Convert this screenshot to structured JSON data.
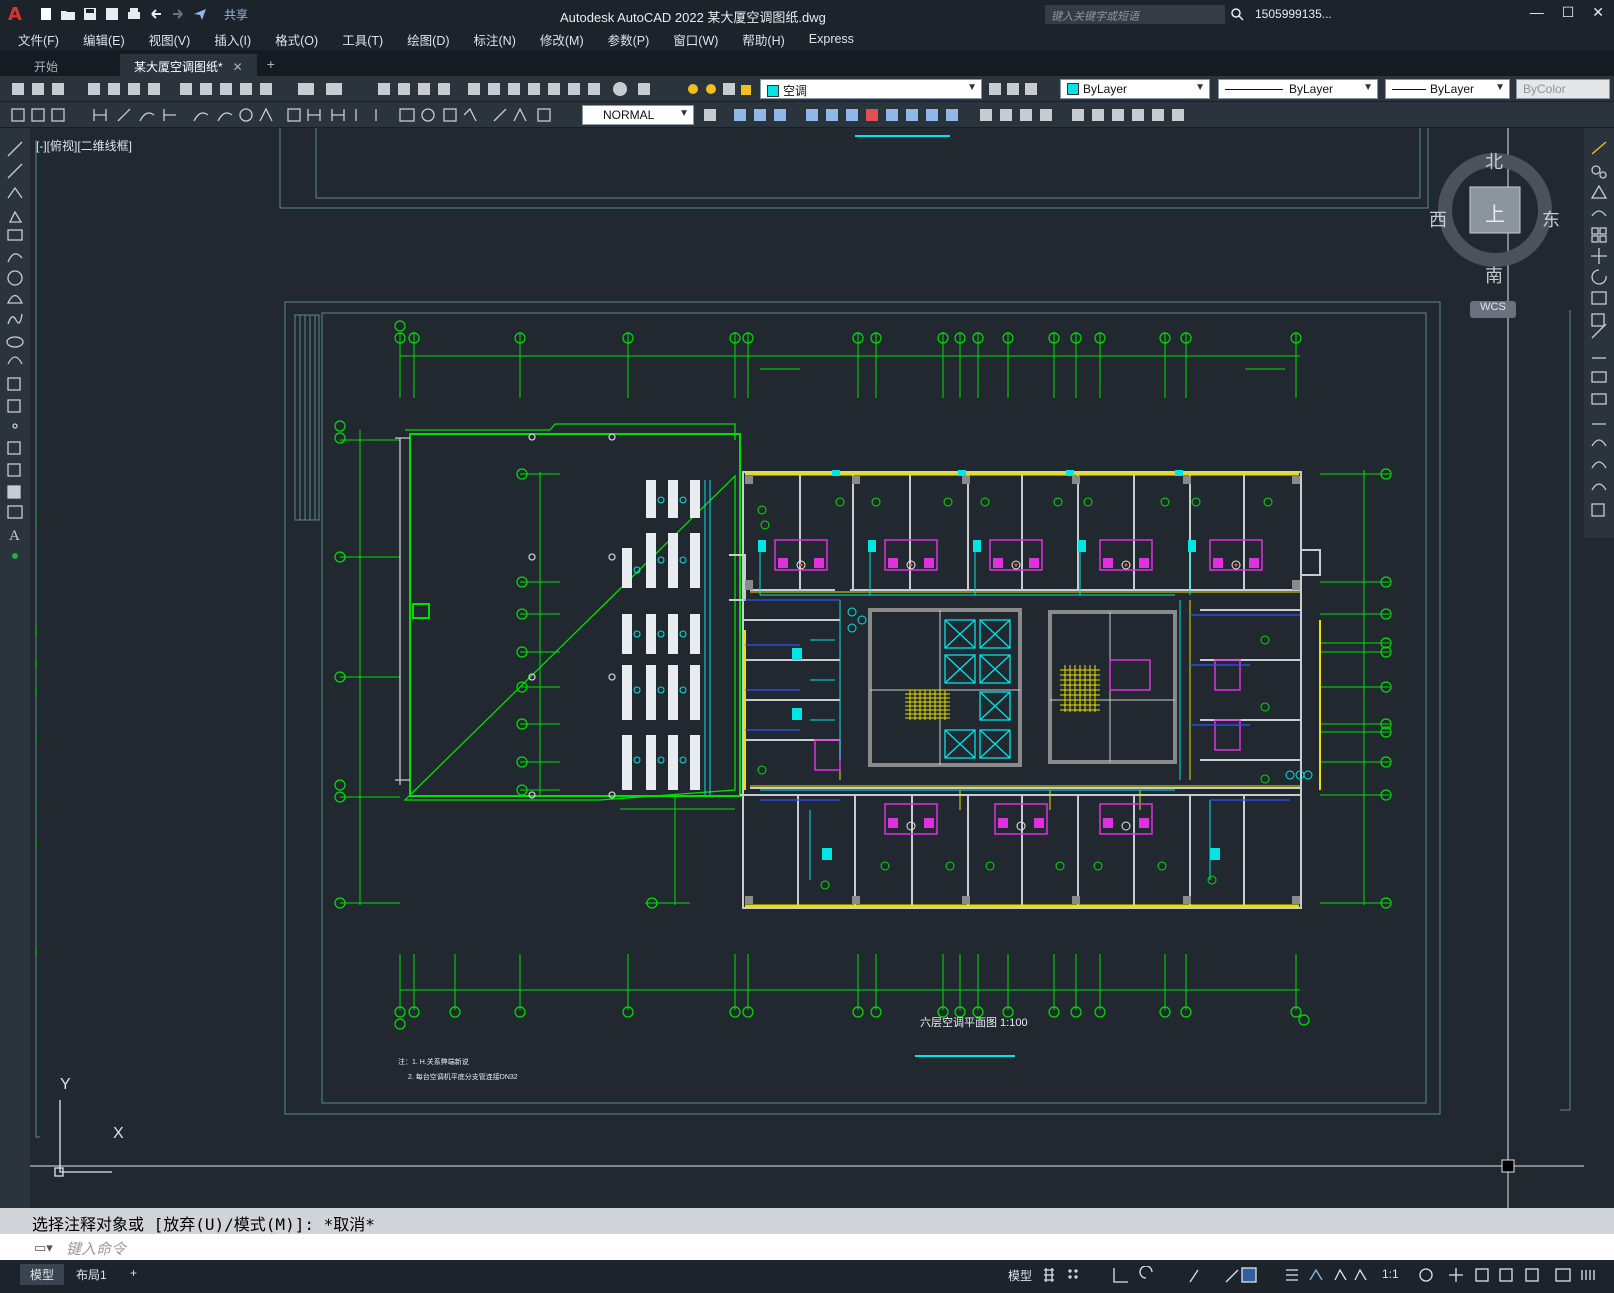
{
  "app": {
    "title": "Autodesk AutoCAD 2022    某大厦空调图纸.dwg",
    "share_label": "共享",
    "search_placeholder": "键入关键字或短语",
    "user": "1505999135...",
    "logo": "A"
  },
  "menu": [
    "文件(F)",
    "编辑(E)",
    "视图(V)",
    "插入(I)",
    "格式(O)",
    "工具(T)",
    "绘图(D)",
    "标注(N)",
    "修改(M)",
    "参数(P)",
    "窗口(W)",
    "帮助(H)",
    "Express"
  ],
  "tabs": [
    {
      "label": "开始",
      "active": false
    },
    {
      "label": "某大厦空调图纸*",
      "active": true
    }
  ],
  "toolbar": {
    "layer_name": "空调",
    "color": "ByLayer",
    "linetype": "ByLayer",
    "lineweight": "ByLayer",
    "plotstyle": "ByColor",
    "style": "NORMAL"
  },
  "viewport": {
    "label": "[-][俯视][二维线框]",
    "compass": {
      "north": "北",
      "south": "南",
      "east": "东",
      "west": "西",
      "top": "上"
    },
    "wcs": "WCS",
    "ucs_x": "X",
    "ucs_y": "Y"
  },
  "drawing": {
    "plan_title": "六层空调平面图 1:100",
    "note1": "注：1. H.关系弊端新说",
    "note2": "2. 每台空调机平底分支管连接DN32"
  },
  "command": {
    "history": "选择注释对象或 [放弃(U)/模式(M)]: *取消*",
    "input_placeholder": "键入命令"
  },
  "status": {
    "layouts": [
      "模型",
      "布局1"
    ],
    "model_label": "模型",
    "scale": "1:1"
  },
  "colors": {
    "bg": "#212830",
    "green": "#00e000",
    "cyan": "#00e5e5",
    "magenta": "#e030e0",
    "yellow": "#e8e000",
    "white": "#e8ecf0",
    "frame": "#5a8a8a"
  }
}
